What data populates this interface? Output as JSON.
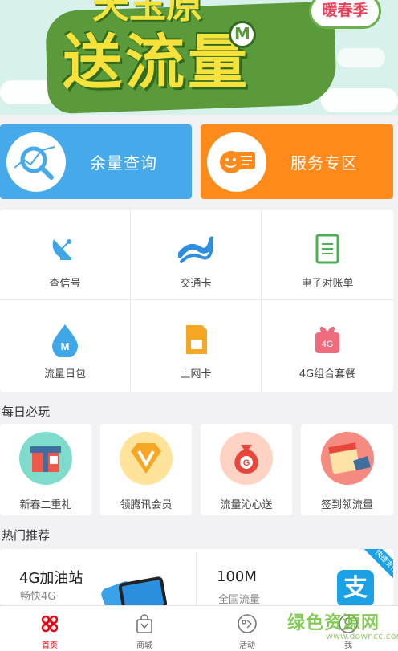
{
  "banner": {
    "title": "送流量",
    "top_text": "天玉原",
    "badge": "暖春季",
    "coin": "M"
  },
  "quick_actions": [
    {
      "label": "余量查询",
      "icon": "magnifier-chart-icon"
    },
    {
      "label": "服务专区",
      "icon": "smiley-chat-icon"
    }
  ],
  "services": [
    {
      "label": "查信号",
      "icon": "satellite-dish-icon"
    },
    {
      "label": "交通卡",
      "icon": "transit-card-icon"
    },
    {
      "label": "电子对账单",
      "icon": "document-icon"
    },
    {
      "label": "流量日包",
      "icon": "data-drop-icon"
    },
    {
      "label": "上网卡",
      "icon": "sim-card-icon"
    },
    {
      "label": "4G组合套餐",
      "icon": "gift-package-icon"
    }
  ],
  "daily": {
    "title": "每日必玩",
    "items": [
      {
        "label": "新春二重礼",
        "icon": "gift-box-icon"
      },
      {
        "label": "领腾讯会员",
        "icon": "vip-diamond-icon"
      },
      {
        "label": "流量沁心送",
        "icon": "money-bag-icon"
      },
      {
        "label": "签到领流量",
        "icon": "calendar-hand-icon"
      }
    ]
  },
  "hot": {
    "title": "热门推荐",
    "left": {
      "title": "4G加油站",
      "subtitle": "畅快4G"
    },
    "right": {
      "title": "100M",
      "subtitle": "全国流量",
      "ribbon": "快捷支付"
    },
    "alipay_glyph": "支"
  },
  "tabs": [
    {
      "label": "首页",
      "icon": "unicom-logo-icon",
      "active": true
    },
    {
      "label": "商城",
      "icon": "shopping-bag-icon",
      "active": false
    },
    {
      "label": "活动",
      "icon": "activity-icon",
      "active": false
    },
    {
      "label": "我",
      "icon": "user-icon",
      "active": false
    }
  ],
  "watermark": {
    "main": "绿色资源网",
    "sub": "www.downcc.com"
  },
  "colors": {
    "blue": "#45a9ea",
    "orange": "#ff8a1c",
    "brand_red": "#e60012"
  }
}
